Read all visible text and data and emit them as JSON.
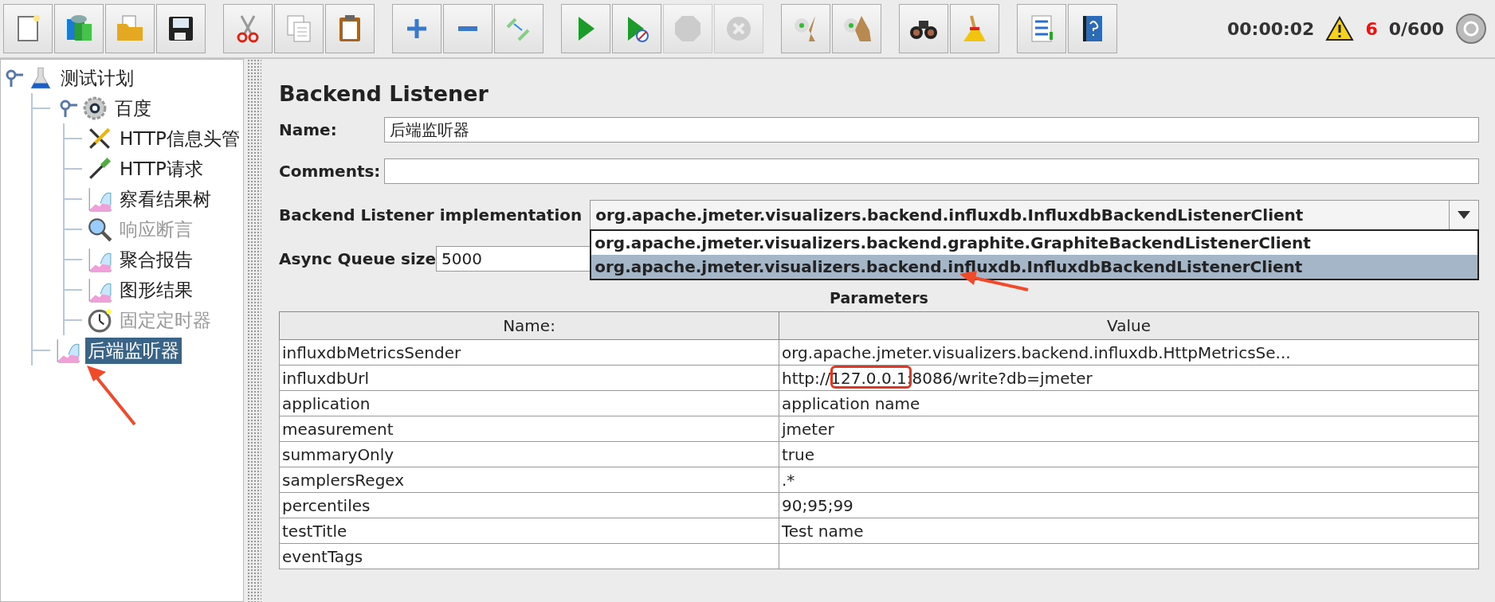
{
  "toolbar": {
    "groups": [
      [
        {
          "kind": "new",
          "disabled": false
        },
        {
          "kind": "templates",
          "disabled": false
        },
        {
          "kind": "open",
          "disabled": false
        },
        {
          "kind": "save",
          "disabled": false
        }
      ],
      [
        {
          "kind": "cut",
          "disabled": false
        },
        {
          "kind": "copy",
          "disabled": false
        },
        {
          "kind": "paste",
          "disabled": false
        }
      ],
      [
        {
          "kind": "expand",
          "disabled": false
        },
        {
          "kind": "collapse",
          "disabled": false
        },
        {
          "kind": "toggle",
          "disabled": false
        }
      ],
      [
        {
          "kind": "start",
          "disabled": false
        },
        {
          "kind": "start_no_timers",
          "disabled": false
        },
        {
          "kind": "stop",
          "disabled": true
        },
        {
          "kind": "shutdown",
          "disabled": true
        }
      ],
      [
        {
          "kind": "clear",
          "disabled": false
        },
        {
          "kind": "clear_all",
          "disabled": false
        }
      ],
      [
        {
          "kind": "search",
          "disabled": false
        },
        {
          "kind": "reset_search",
          "disabled": false
        }
      ],
      [
        {
          "kind": "functions",
          "disabled": false
        },
        {
          "kind": "help",
          "disabled": false
        }
      ]
    ],
    "status": {
      "elapsed": "00:00:02",
      "warnings": "6",
      "threads": "0/600"
    }
  },
  "tree": [
    {
      "label": "测试计划",
      "kind": "plan",
      "expanded": true,
      "selected": false,
      "disabled": false,
      "children": [
        {
          "label": "百度",
          "kind": "thread_group",
          "expanded": true,
          "selected": false,
          "disabled": false,
          "children": [
            {
              "label": "HTTP信息头管",
              "kind": "config",
              "selected": false,
              "disabled": false
            },
            {
              "label": "HTTP请求",
              "kind": "sampler",
              "selected": false,
              "disabled": false
            },
            {
              "label": "察看结果树",
              "kind": "listener",
              "selected": false,
              "disabled": false
            },
            {
              "label": "响应断言",
              "kind": "assertion",
              "selected": false,
              "disabled": true
            },
            {
              "label": "聚合报告",
              "kind": "listener",
              "selected": false,
              "disabled": false
            },
            {
              "label": "图形结果",
              "kind": "listener",
              "selected": false,
              "disabled": false
            },
            {
              "label": "固定定时器",
              "kind": "timer",
              "selected": false,
              "disabled": true
            }
          ]
        },
        {
          "label": "后端监听器",
          "kind": "listener",
          "selected": true,
          "disabled": false
        }
      ]
    }
  ],
  "panel": {
    "title": "Backend Listener",
    "name": {
      "label": "Name:",
      "value": "后端监听器"
    },
    "comments": {
      "label": "Comments:"
    },
    "implementation": {
      "label": "Backend Listener implementation",
      "value": "org.apache.jmeter.visualizers.backend.influxdb.InfluxdbBackendListenerClient",
      "expanded": true,
      "options": [
        {
          "label": "org.apache.jmeter.visualizers.backend.graphite.GraphiteBackendListenerClient",
          "selected": false
        },
        {
          "label": "org.apache.jmeter.visualizers.backend.influxdb.InfluxdbBackendListenerClient",
          "selected": true
        }
      ]
    },
    "queue": {
      "label": "Async Queue size",
      "value": "5000"
    },
    "parameters": {
      "title": "Parameters",
      "columns": [
        "Name:",
        "Value"
      ],
      "rows": [
        {
          "name": "influxdbMetricsSender",
          "value": "org.apache.jmeter.visualizers.backend.influxdb.HttpMetricsSe...",
          "annotated": false
        },
        {
          "name": "influxdbUrl",
          "value": "http://127.0.0.1:8086/write?db=jmeter",
          "annotated": true
        },
        {
          "name": "application",
          "value": "application name",
          "annotated": false
        },
        {
          "name": "measurement",
          "value": "jmeter",
          "annotated": false
        },
        {
          "name": "summaryOnly",
          "value": "true",
          "annotated": false
        },
        {
          "name": "samplersRegex",
          "value": ".*",
          "annotated": false
        },
        {
          "name": "percentiles",
          "value": "90;95;99",
          "annotated": false
        },
        {
          "name": "testTitle",
          "value": "Test name",
          "annotated": false
        },
        {
          "name": "eventTags",
          "annotated": false
        }
      ]
    }
  }
}
